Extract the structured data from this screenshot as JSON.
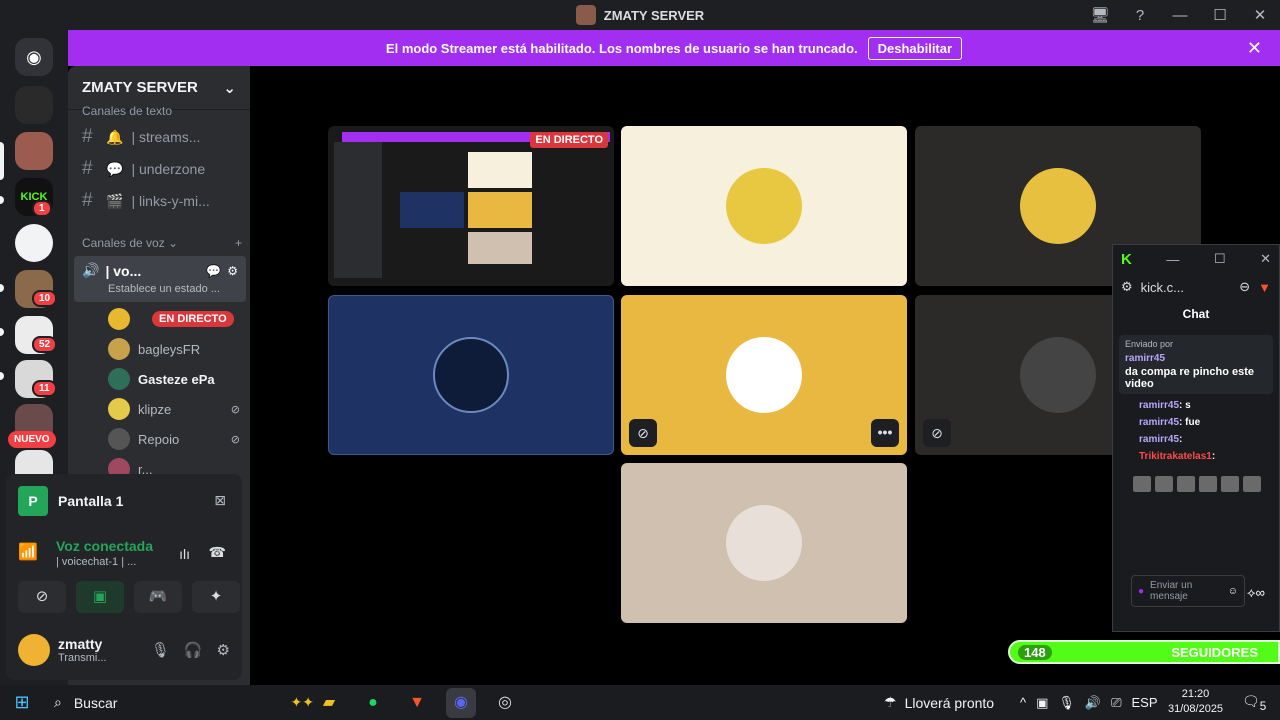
{
  "window": {
    "title": "ZMATY SERVER",
    "controls": [
      "🖥",
      "?",
      "—",
      "☐",
      "✕"
    ]
  },
  "banner": {
    "text": "El modo Streamer está habilitado. Los nombres de usuario se han truncado.",
    "button": "Deshabilitar",
    "close": "✕"
  },
  "rail": {
    "badges": [
      "1",
      "10",
      "52",
      "11"
    ],
    "new_label": "NUEVO"
  },
  "sidebar": {
    "server_name": "ZMATY SERVER",
    "text_category": "Canales de texto",
    "text_channels": [
      {
        "icon": "🔔",
        "name": "| streams..."
      },
      {
        "icon": "💬",
        "name": "| underzone"
      },
      {
        "icon": "🎬",
        "name": "| links-y-mi..."
      }
    ],
    "voice_category": "Canales de voz",
    "voice_channel": {
      "name": "| vo...",
      "status": "Establece un estado ..."
    },
    "voice_users": [
      {
        "name": "",
        "live": "EN DIRECTO",
        "color": "#e8b830"
      },
      {
        "name": "bagleysFR",
        "color": "#c7a24a"
      },
      {
        "name": "Gasteze ePa",
        "color": "#2f6f5a"
      },
      {
        "name": "klipze",
        "color": "#e5c94a"
      },
      {
        "name": "Repoio",
        "color": "#555"
      },
      {
        "name": "r...",
        "color": "#a04860"
      }
    ]
  },
  "voice_panel": {
    "screen_label": "Pantalla 1",
    "connected": "Voz conectada",
    "channel": "| voicechat-1 | ...",
    "user": "zmatty",
    "user_status": "Transmi..."
  },
  "stage": {
    "live_badge": "EN DIRECTO",
    "more": "•••"
  },
  "kick": {
    "logo": "K",
    "url": "kick.c...",
    "chat_title": "Chat",
    "pinned_label": "Enviado por",
    "pinned_user": "ramirr45",
    "pinned_text": "da compa re pincho este video",
    "messages": [
      {
        "user": "ramirr45",
        "text": ": s"
      },
      {
        "user": "ramirr45",
        "text": ": fue"
      },
      {
        "user": "ramirr45",
        "text": ":"
      },
      {
        "user": "Trikitrakatelas1",
        "text": ":"
      }
    ],
    "send_placeholder": "Enviar un mensaje"
  },
  "followers": {
    "count": "148",
    "label": "SEGUIDORES"
  },
  "taskbar": {
    "search": "Buscar",
    "weather": "Lloverá pronto",
    "lang": "ESP",
    "time": "21:20",
    "date": "31/08/2025",
    "notif_count": "5"
  }
}
